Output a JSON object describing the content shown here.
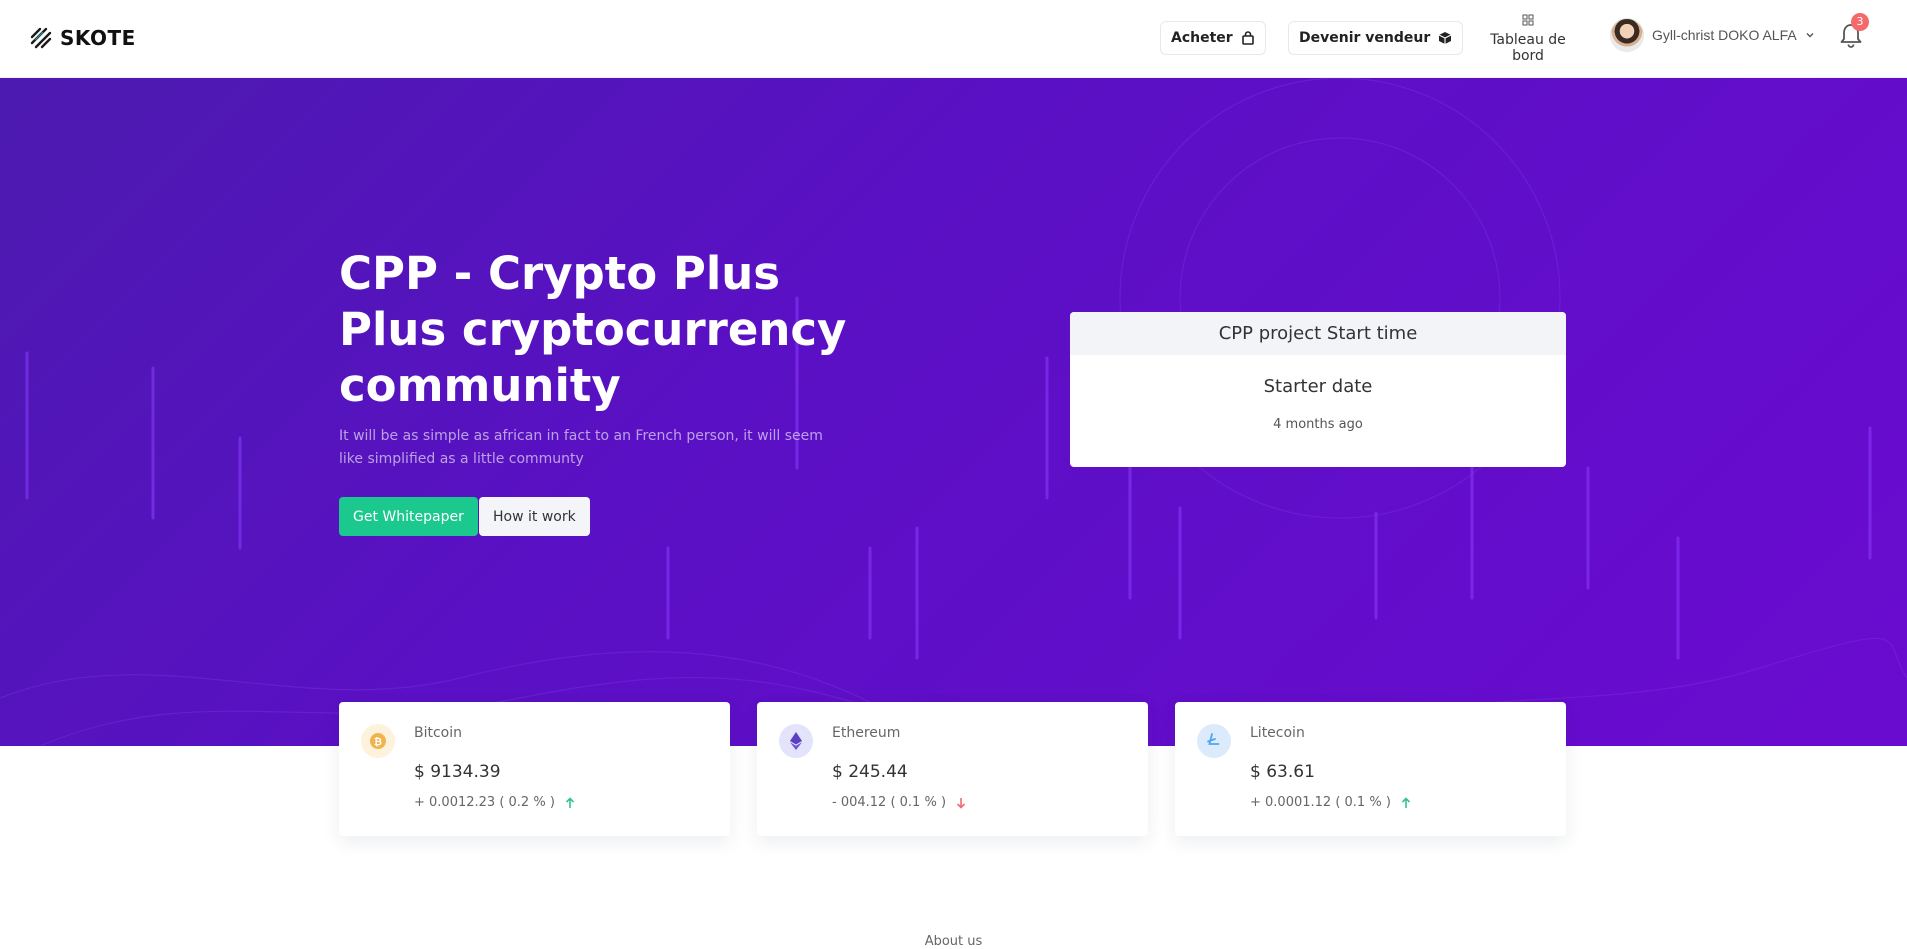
{
  "brand": {
    "logo_text": "SKOTE"
  },
  "header": {
    "buy_button": "Acheter",
    "seller_button": "Devenir vendeur",
    "dashboard_link": "Tableau de bord",
    "user_name": "Gyll-christ DOKO ALFA",
    "notification_count": "3"
  },
  "hero": {
    "title": "CPP - Crypto Plus Plus cryptocurrency community",
    "subtitle": "It will be as simple as african in fact to an French person, it will seem like simplified as a little communty",
    "primary_button": "Get Whitepaper",
    "secondary_button": "How it work"
  },
  "start_card": {
    "header": "CPP project Start time",
    "title": "Starter date",
    "time": "4 months ago"
  },
  "coins": [
    {
      "name": "Bitcoin",
      "price": "$ 9134.39",
      "change": "+ 0.0012.23 ( 0.2 % )",
      "trend": "up",
      "icon": "bitcoin-icon",
      "color": "#f1b44c"
    },
    {
      "name": "Ethereum",
      "price": "$ 245.44",
      "change": "- 004.12 ( 0.1 % )",
      "trend": "down",
      "icon": "ethereum-icon",
      "color": "#556ee6"
    },
    {
      "name": "Litecoin",
      "price": "$ 63.61",
      "change": "+ 0.0001.12 ( 0.1 % )",
      "trend": "up",
      "icon": "litecoin-icon",
      "color": "#50a5f1"
    }
  ],
  "footer_section": {
    "about_label": "About us"
  },
  "colors": {
    "hero_start": "#4c1ab0",
    "hero_end": "#6a0bd0",
    "accent_green": "#1bc98e",
    "badge_red": "#f46a6a",
    "up_green": "#34c38f",
    "down_red": "#f46a6a"
  }
}
